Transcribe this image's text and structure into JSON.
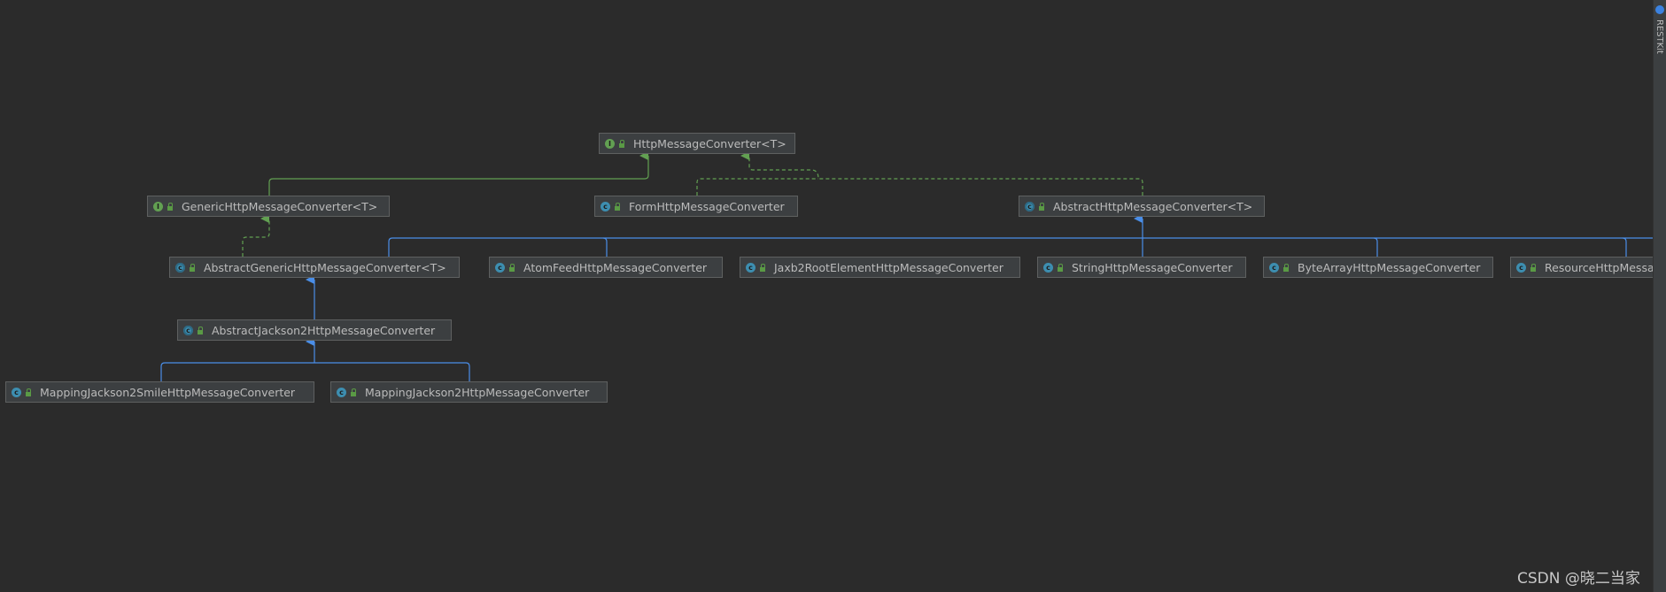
{
  "diagram": {
    "nodes": [
      {
        "id": "httpmc",
        "label": "HttpMessageConverter<T>",
        "kind": "interface"
      },
      {
        "id": "generic",
        "label": "GenericHttpMessageConverter<T>",
        "kind": "interface"
      },
      {
        "id": "form",
        "label": "FormHttpMessageConverter",
        "kind": "class"
      },
      {
        "id": "abstract",
        "label": "AbstractHttpMessageConverter<T>",
        "kind": "abstract"
      },
      {
        "id": "abstractgeneric",
        "label": "AbstractGenericHttpMessageConverter<T>",
        "kind": "abstract"
      },
      {
        "id": "atomfeed",
        "label": "AtomFeedHttpMessageConverter",
        "kind": "class"
      },
      {
        "id": "jaxb2",
        "label": "Jaxb2RootElementHttpMessageConverter",
        "kind": "class"
      },
      {
        "id": "string",
        "label": "StringHttpMessageConverter",
        "kind": "class"
      },
      {
        "id": "bytearray",
        "label": "ByteArrayHttpMessageConverter",
        "kind": "class"
      },
      {
        "id": "resource",
        "label": "ResourceHttpMessageConverter",
        "kind": "class"
      },
      {
        "id": "abstractjackson2",
        "label": "AbstractJackson2HttpMessageConverter",
        "kind": "abstract"
      },
      {
        "id": "smile",
        "label": "MappingJackson2SmileHttpMessageConverter",
        "kind": "class"
      },
      {
        "id": "mapping",
        "label": "MappingJackson2HttpMessageConverter",
        "kind": "class"
      }
    ],
    "edges": [
      {
        "from": "generic",
        "to": "httpmc",
        "type": "extends"
      },
      {
        "from": "form",
        "to": "httpmc",
        "type": "implements"
      },
      {
        "from": "abstract",
        "to": "httpmc",
        "type": "implements"
      },
      {
        "from": "abstractgeneric",
        "to": "generic",
        "type": "implements"
      },
      {
        "from": "abstractgeneric",
        "to": "abstract",
        "type": "extends"
      },
      {
        "from": "atomfeed",
        "to": "abstract",
        "type": "extends"
      },
      {
        "from": "jaxb2",
        "to": "abstract",
        "type": "extends"
      },
      {
        "from": "string",
        "to": "abstract",
        "type": "extends"
      },
      {
        "from": "bytearray",
        "to": "abstract",
        "type": "extends"
      },
      {
        "from": "resource",
        "to": "abstract",
        "type": "extends"
      },
      {
        "from": "abstractjackson2",
        "to": "abstractgeneric",
        "type": "extends"
      },
      {
        "from": "smile",
        "to": "abstractjackson2",
        "type": "extends"
      },
      {
        "from": "mapping",
        "to": "abstractjackson2",
        "type": "extends"
      }
    ],
    "colors": {
      "interface_edge": "#62a052",
      "class_edge": "#4a8ee8",
      "background": "#2b2b2b"
    },
    "kind_letters": {
      "interface": "I",
      "class": "c",
      "abstract": "c"
    }
  },
  "sidebar": {
    "tool_window": "RESTKit",
    "icon": "restkit-icon"
  },
  "watermark": "CSDN @晓二当家"
}
